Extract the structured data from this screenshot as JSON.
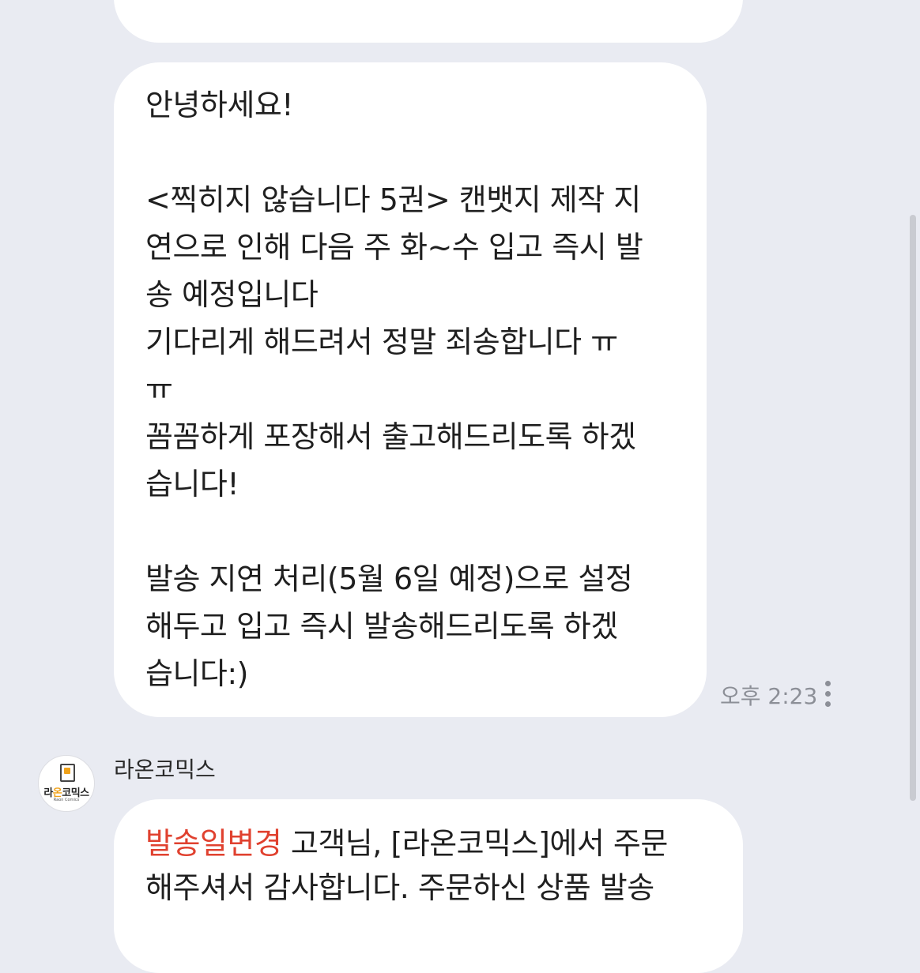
{
  "previous_message": {
    "has_image": true
  },
  "message": {
    "lines": [
      "안녕하세요!",
      "",
      "<찍히지 않습니다 5권> 캔뱃지 제작 지",
      "연으로 인해 다음 주 화~수 입고 즉시 발",
      "송 예정입니다",
      "기다리게 해드려서 정말 죄송합니다 ㅠ",
      "ㅠ",
      "꼼꼼하게 포장해서 출고해드리도록 하겠",
      "습니다!",
      "",
      "발송 지연 처리(5월 6일 예정)으로 설정",
      "해두고 입고 즉시 발송해드리도록 하겠",
      "습니다:)"
    ],
    "time": "오후 2:23",
    "more_icon": "vertical-ellipsis-icon"
  },
  "next_message": {
    "sender": "라온코믹스",
    "avatar": {
      "logo_text_a": "라",
      "logo_text_b": "온",
      "logo_text_c": "코믹스",
      "logo_sub": "Raon Comics"
    },
    "tag": "발송일변경",
    "line1_rest": " 고객님, [라온코믹스]에서 주문",
    "line2": "해주셔서 감사합니다. 주문하신 상품 발송",
    "tag_color": "#e0412f"
  },
  "colors": {
    "background": "#e9ebf2",
    "bubble": "#ffffff",
    "meta_text": "#8c8f97"
  }
}
